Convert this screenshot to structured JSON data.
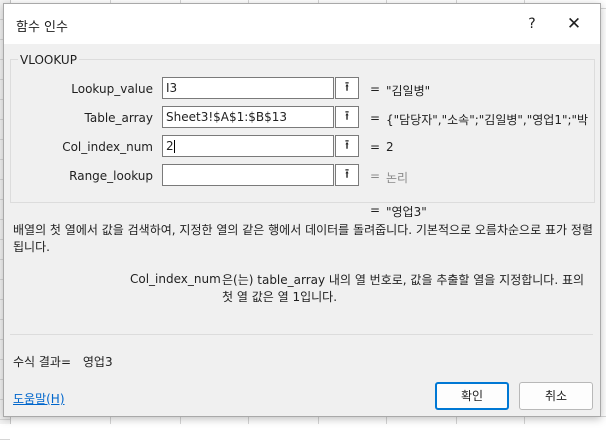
{
  "dialog": {
    "title": "함수 인수",
    "help_glyph": "?",
    "close_glyph": "✕",
    "function_name": "VLOOKUP"
  },
  "args": [
    {
      "label": "Lookup_value",
      "value": "I3",
      "result": "\"김일병\"",
      "muted": false
    },
    {
      "label": "Table_array",
      "value": "Sheet3!$A$1:$B$13",
      "result": "{\"담당자\",\"소속\";\"김일병\",\"영업1\";\"박ㅊ",
      "muted": false
    },
    {
      "label": "Col_index_num",
      "value": "2",
      "result": "2",
      "muted": false
    },
    {
      "label": "Range_lookup",
      "value": "",
      "result": "논리",
      "muted": true
    }
  ],
  "ref_icon": "collapse-arrow-icon",
  "ref_glyph": "⭱",
  "equals_sign": "=",
  "overall_result": "\"영업3\"",
  "description": "배열의 첫 열에서 값을 검색하여, 지정한 열의 같은 행에서 데이터를 돌려줍니다. 기본적으로 오름차순으로 표가 정렬됩니다.",
  "arg_help": {
    "name": "Col_index_num",
    "text": "은(는) table_array 내의 열 번호로, 값을 추출할 열을 지정합니다. 표의 첫 열 값은 열 1입니다."
  },
  "formula_result": {
    "label": "수식 결과=",
    "value": "영업3"
  },
  "help_link": "도움말(H)",
  "buttons": {
    "ok": "확인",
    "cancel": "취소"
  },
  "colors": {
    "accent": "#0078d4",
    "link": "#0066cc",
    "muted_text": "#8a8a8a"
  }
}
